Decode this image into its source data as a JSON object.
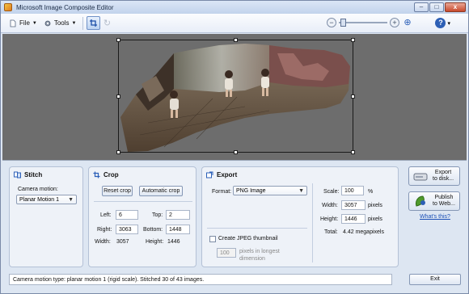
{
  "window": {
    "title": "Microsoft Image Composite Editor",
    "minimize": "–",
    "maximize": "□",
    "close": "x"
  },
  "toolbar": {
    "file_label": "File",
    "tools_label": "Tools",
    "zoom_out": "−",
    "zoom_in": "+",
    "help_chevron": "▾"
  },
  "stitch": {
    "title": "Stitch",
    "camera_motion_label": "Camera motion:",
    "camera_motion_value": "Planar Motion 1"
  },
  "crop": {
    "title": "Crop",
    "reset_button": "Reset crop",
    "auto_button": "Automatic crop",
    "left_label": "Left:",
    "left_value": "6",
    "top_label": "Top:",
    "top_value": "2",
    "right_label": "Right:",
    "right_value": "3063",
    "bottom_label": "Bottom:",
    "bottom_value": "1448",
    "width_label": "Width:",
    "width_value": "3057",
    "height_label": "Height:",
    "height_value": "1446"
  },
  "export": {
    "title": "Export",
    "format_label": "Format:",
    "format_value": "PNG Image",
    "scale_label": "Scale:",
    "scale_value": "100",
    "scale_unit": "%",
    "width_label": "Width:",
    "width_value": "3057",
    "width_unit": "pixels",
    "height_label": "Height:",
    "height_value": "1446",
    "height_unit": "pixels",
    "total_label": "Total:",
    "total_value": "4.42 megapixels",
    "jpeg_thumb_label": "Create JPEG thumbnail",
    "thumb_value": "100",
    "thumb_unit_line1": "pixels in longest",
    "thumb_unit_line2": "dimension"
  },
  "actions": {
    "export_disk_line1": "Export",
    "export_disk_line2": "to disk...",
    "publish_line1": "Publish",
    "publish_line2": "to Web...",
    "whats_this": "What's this?",
    "exit": "Exit"
  },
  "status": {
    "text": "Camera motion type: planar motion 1 (rigid scale). Stitched 30 of 43 images."
  }
}
